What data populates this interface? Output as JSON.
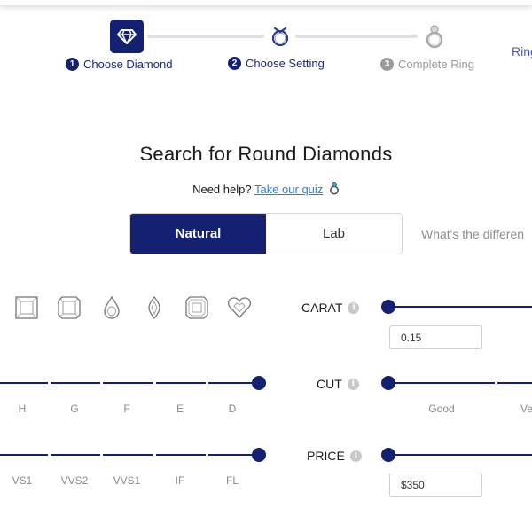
{
  "steps": [
    {
      "number": "1",
      "label": "Choose Diamond",
      "icon": "diamond-icon",
      "state": "active"
    },
    {
      "number": "2",
      "label": "Choose Setting",
      "icon": "ring-setting-icon",
      "state": "active"
    },
    {
      "number": "3",
      "label": "Complete Ring",
      "icon": "complete-ring-icon",
      "state": "inactive"
    }
  ],
  "header_link": "Ring",
  "page_title": "Search for Round Diamonds",
  "help": {
    "prefix": "Need help?",
    "link": "Take our quiz",
    "icon": "ring-quiz-icon"
  },
  "toggle": {
    "options": [
      "Natural",
      "Lab"
    ],
    "selected": "Natural"
  },
  "whats_difference": "What's the differen",
  "shapes": [
    {
      "name": "princess"
    },
    {
      "name": "cushion"
    },
    {
      "name": "pear"
    },
    {
      "name": "marquise"
    },
    {
      "name": "asscher"
    },
    {
      "name": "heart"
    }
  ],
  "filters": {
    "carat": {
      "label": "CARAT",
      "min_value": "0.15",
      "info_icon": "i"
    },
    "cut": {
      "label": "CUT",
      "info_icon": "i",
      "tick_labels": [
        "Good",
        "Ve"
      ]
    },
    "price": {
      "label": "PRICE",
      "min_value": "$350",
      "info_icon": "i"
    },
    "color": {
      "tick_labels": [
        "H",
        "G",
        "F",
        "E",
        "D"
      ]
    },
    "clarity": {
      "tick_labels": [
        "VS1",
        "VVS2",
        "VVS1",
        "IF",
        "FL"
      ]
    }
  },
  "colors": {
    "brand": "#142070",
    "link": "#2a7fd8",
    "muted": "#9a9a9a"
  }
}
